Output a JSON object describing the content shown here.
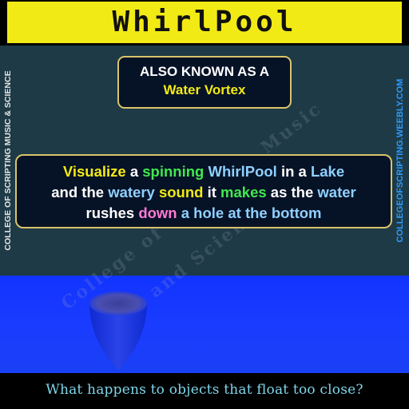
{
  "title": "WhirlPool",
  "aka": {
    "line1": "ALSO KNOWN AS A",
    "line2": "Water Vortex"
  },
  "description": {
    "line1": [
      {
        "text": "Visualize ",
        "color": "yellow"
      },
      {
        "text": "a ",
        "color": "white"
      },
      {
        "text": "spinning ",
        "color": "green"
      },
      {
        "text": "WhirlPool ",
        "color": "blue"
      },
      {
        "text": "in a ",
        "color": "white"
      },
      {
        "text": "Lake",
        "color": "blue"
      }
    ],
    "line2": [
      {
        "text": "and the ",
        "color": "white"
      },
      {
        "text": "watery ",
        "color": "blue"
      },
      {
        "text": "sound ",
        "color": "yellow"
      },
      {
        "text": "it ",
        "color": "white"
      },
      {
        "text": "makes ",
        "color": "green"
      },
      {
        "text": "as the ",
        "color": "white"
      },
      {
        "text": "water",
        "color": "blue"
      }
    ],
    "line3": [
      {
        "text": "rushes ",
        "color": "white"
      },
      {
        "text": "down ",
        "color": "pink"
      },
      {
        "text": "a hole at the bottom",
        "color": "blue"
      }
    ]
  },
  "side_left": "COLLEGE OF SCRIPTING MUSIC & SCIENCE",
  "side_right": "COLLEGEOFSCRIPTING.WEEBLY.COM",
  "watermark": {
    "line1": "College of Scripting Music",
    "line2": "and Science"
  },
  "footer": "What happens to objects that float too close?",
  "colors": {
    "title_bg": "#f2ea15",
    "panel_bg": "#1e3a46",
    "water": "#1a3cff",
    "box_bg": "#061226",
    "box_border": "#d9c46a",
    "footer_text": "#7ed6ea"
  },
  "icons": {
    "vortex": "whirlpool-funnel-icon"
  }
}
